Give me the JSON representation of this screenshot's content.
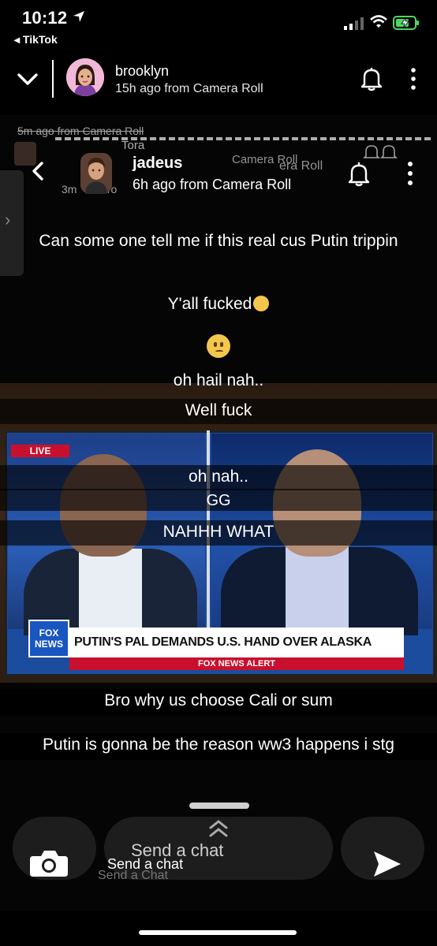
{
  "status_bar": {
    "time": "10:12",
    "back_app": "◂ TikTok"
  },
  "header": {
    "username": "brooklyn",
    "subtitle": "15h ago from Camera Roll"
  },
  "media": {
    "ghost_lines": {
      "line1": "5m ago from Camera Roll",
      "tora": "Tora",
      "roll": "Camera Roll",
      "roll2": "era Roll",
      "three_m": "3m",
      "froc": "fro"
    },
    "inner_header": {
      "username": "jadeus",
      "subtitle": "6h ago from Camera Roll"
    },
    "captions": {
      "c1": "Can some one tell me if this real cus Putin trippin",
      "c2": "Y'all fucked",
      "c3": "oh hail nah..",
      "c4": "Well fuck",
      "c5": "oh nah..",
      "c6": "GG",
      "c7": "NAHHH WHAT",
      "c8": "Bro why us choose Cali or sum",
      "c9": "Putin is gonna be the reason ww3 happens i stg"
    },
    "tv": {
      "live": "LIVE",
      "network": "FOX NEWS",
      "chyron": "PUTIN'S PAL DEMANDS U.S. HAND OVER ALASKA",
      "alert": "FOX NEWS ALERT"
    }
  },
  "bottom_bar": {
    "chat_big": "Send a chat",
    "chat_main": "Send a chat",
    "chat_ghost": "Send a Chat"
  },
  "colors": {
    "background": "#000000",
    "battery_green": "#4cd964",
    "fox_blue": "#1a56c0",
    "alert_red": "#c8102e"
  }
}
